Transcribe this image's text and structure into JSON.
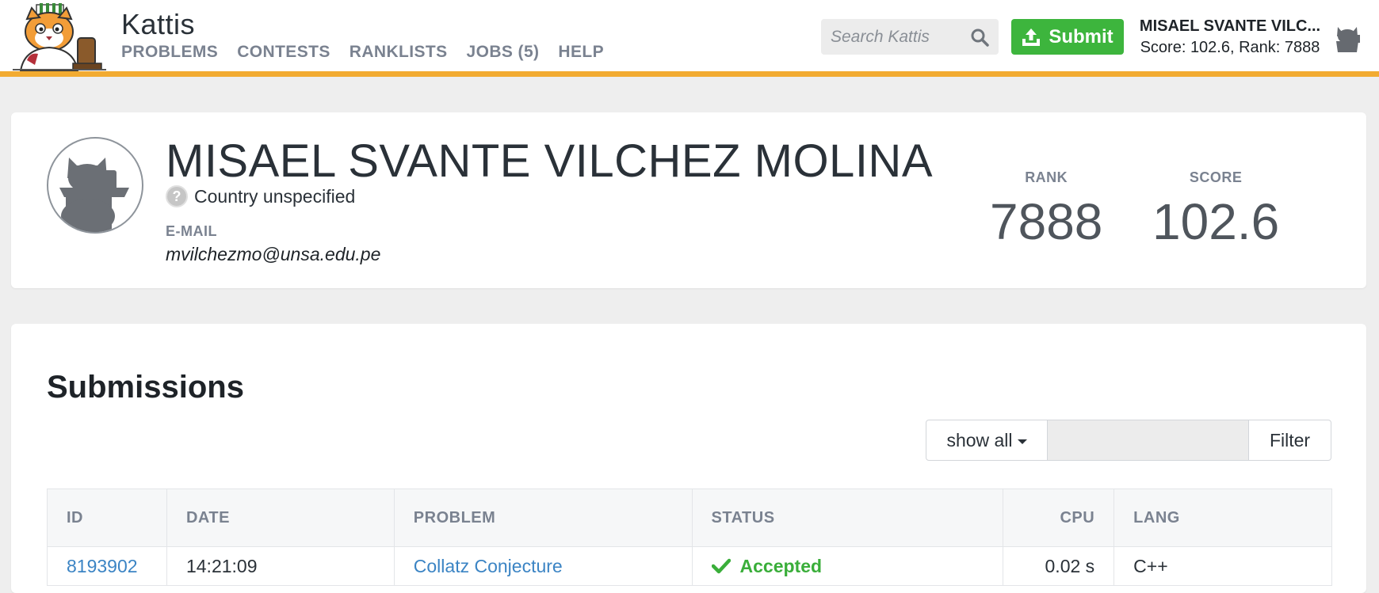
{
  "header": {
    "brand": "Kattis",
    "nav": [
      "PROBLEMS",
      "CONTESTS",
      "RANKLISTS",
      "JOBS (5)",
      "HELP"
    ],
    "search_placeholder": "Search Kattis",
    "submit_label": "Submit",
    "user_name": "MISAEL SVANTE VILC...",
    "user_score_rank": "Score: 102.6, Rank: 7888"
  },
  "profile": {
    "name": "MISAEL SVANTE VILCHEZ MOLINA",
    "country": "Country unspecified",
    "country_icon": "?",
    "email_label": "E-MAIL",
    "email": "mvilchezmo@unsa.edu.pe",
    "rank_label": "RANK",
    "rank": "7888",
    "score_label": "SCORE",
    "score": "102.6"
  },
  "submissions": {
    "title": "Submissions",
    "show_all": "show all",
    "filter_label": "Filter",
    "filter_value": "",
    "columns": [
      "ID",
      "DATE",
      "PROBLEM",
      "STATUS",
      "CPU",
      "LANG"
    ],
    "rows": [
      {
        "id": "8193902",
        "date": "14:21:09",
        "problem": "Collatz Conjecture",
        "status": "Accepted",
        "cpu": "0.02 s",
        "lang": "C++"
      }
    ]
  },
  "colors": {
    "accent": "#f2ab31",
    "submit_green": "#3db53d",
    "accepted_green": "#3aae3a",
    "link_blue": "#3b84c4"
  }
}
